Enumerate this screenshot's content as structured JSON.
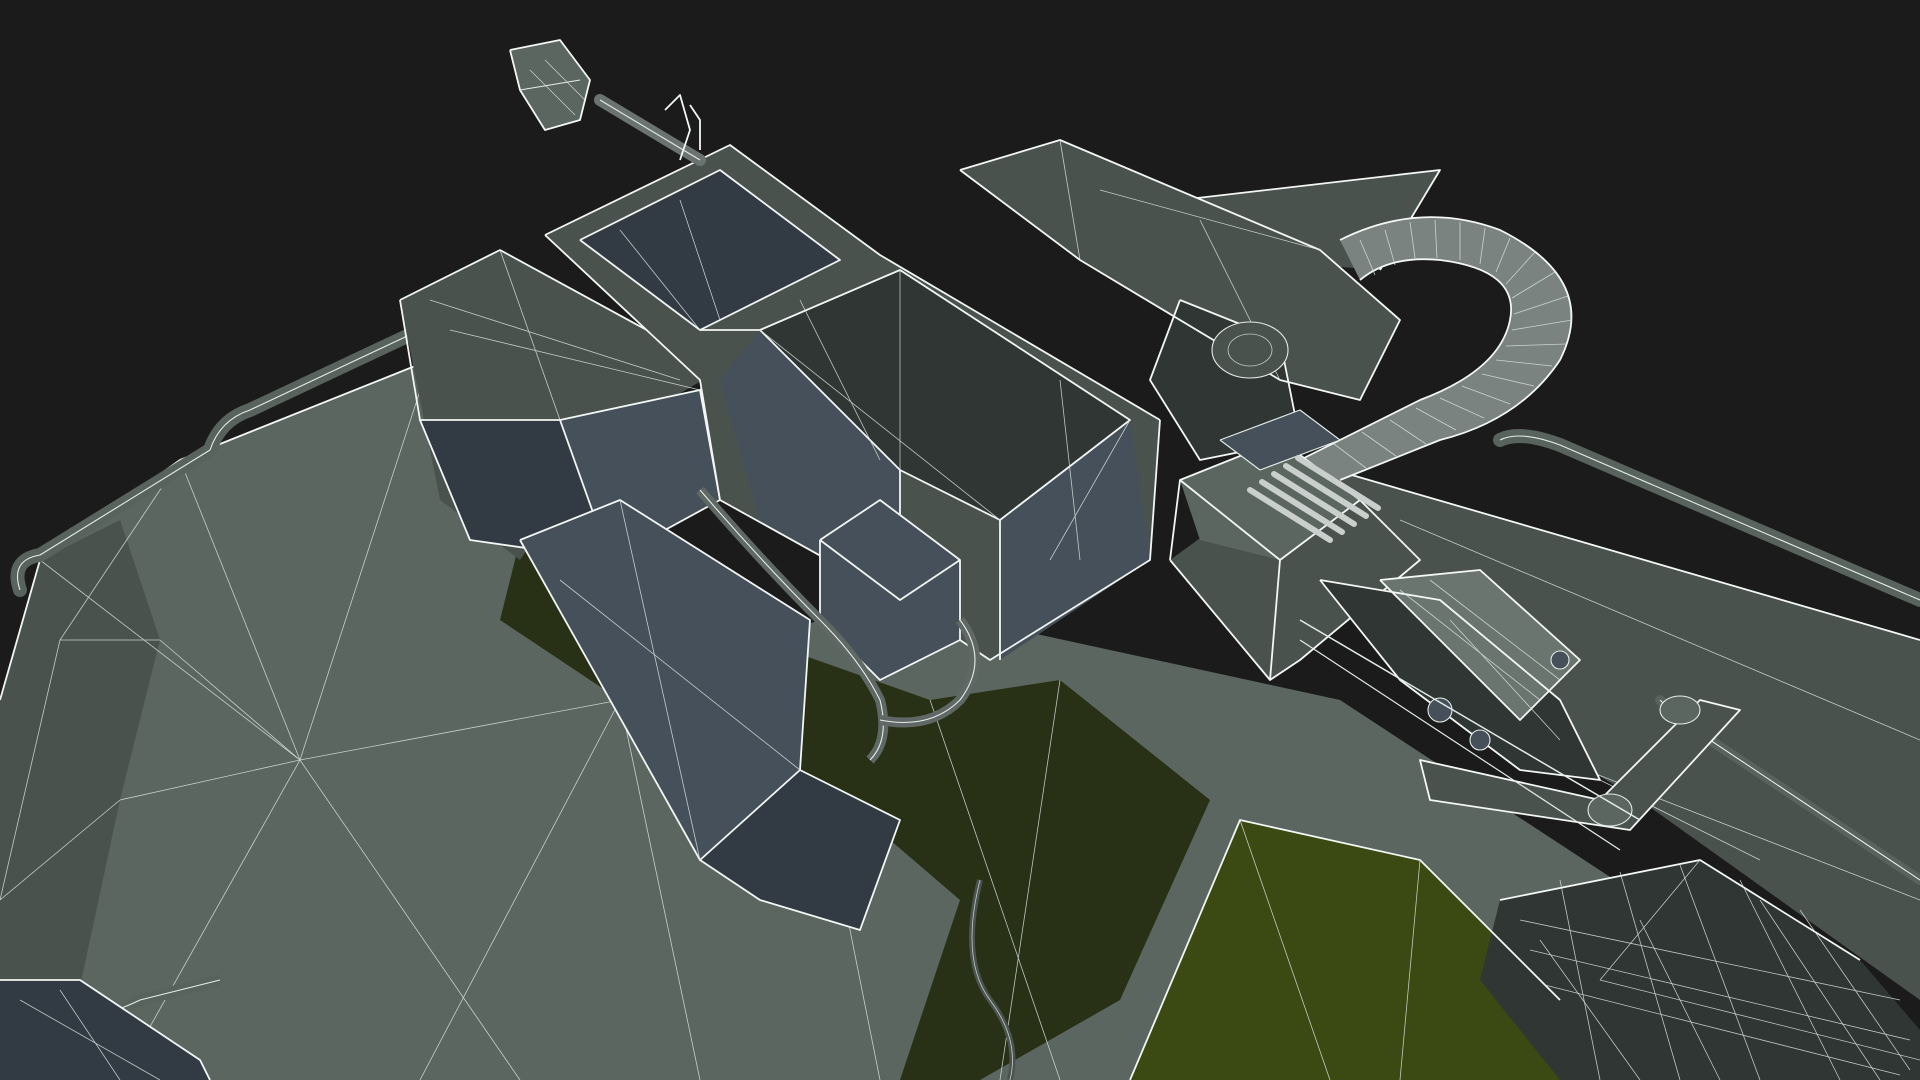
{
  "viewport": {
    "content": "wireframe-3d-model-render",
    "background_color": "#1b1b1b",
    "wire_color": "#e4ece8"
  },
  "materials": {
    "hull_top": "#5c6660",
    "hull_side": "#4a524e",
    "hull_dark": "#2f3633",
    "metal_blue_gray": "#46505a",
    "metal_blue_dark": "#323b44",
    "shadow_olive": "#283015",
    "olive_lit": "#3b4a12",
    "barrel": "#6b7570",
    "ammo_belt": "#7a8380",
    "ammo_rounds": "#c8cfcc"
  }
}
